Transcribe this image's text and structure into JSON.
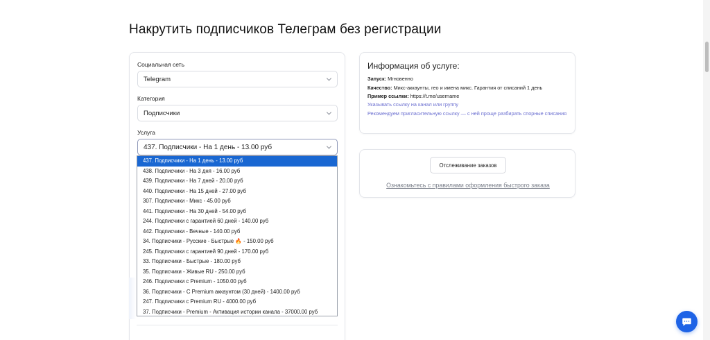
{
  "page": {
    "title": "Накрутить подписчиков Телеграм без регистрации"
  },
  "form": {
    "social_label": "Социальная сеть",
    "social_value": "Telegram",
    "category_label": "Категория",
    "category_value": "Подписчики",
    "service_label": "Услуга",
    "service_value": "437. Подписчики - На 1 день - 13.00 руб",
    "service_options": [
      "437. Подписчики - На 1 день - 13.00 руб",
      "438. Подписчики - На 3 дня - 16.00 руб",
      "439. Подписчики - На 7 дней - 20.00 руб",
      "440. Подписчики - На 15 дней - 27.00 руб",
      "307. Подписчики - Микс - 45.00 руб",
      "441. Подписчики - На 30 дней - 54.00 руб",
      "244. Подписчики с гарантией 60 дней - 140.00 руб",
      "442. Подписчики - Вечные - 140.00 руб",
      "34. Подписчики - Русские - Быстрые 🔥 - 150.00 руб",
      "245. Подписчики с гарантией 90 дней - 170.00 руб",
      "33. Подписчики - Быстрые - 180.00 руб",
      "35. Подписчики - Живые RU - 250.00 руб",
      "246. Подписчики с Premium - 1050.00 руб",
      "36. Подписчики - С Premium аккаунтом (30 дней) - 1400.00 руб",
      "247. Подписчики с Premium RU - 4000.00 руб",
      "37. Подписчики - Premium - Активация истории канала - 37000.00 руб"
    ]
  },
  "info": {
    "title": "Информация об услуге:",
    "launch_label": "Запуск:",
    "launch_value": "Мгновенно",
    "quality_label": "Качество:",
    "quality_value": "Микс-аккаунты, гео и имена микс. Гарантия от списаний 1 день",
    "example_label": "Пример ссылки:",
    "example_value": "https://t.me/username",
    "link_hint": "Указывать ссылку на канал или группу",
    "recommend_hint": "Рекомендуем пригласительную ссылку — с ней проще разбирать спорные списания"
  },
  "tracking": {
    "button_label": "Отслеживание заказов",
    "rules_link": "Ознакомьтесь с правилами оформления быстрого заказа"
  },
  "colors": {
    "accent": "#1967d2",
    "link": "#6b6fd0",
    "chat": "#1e63e6"
  },
  "icons": {
    "chat": "chat-bubble-icon",
    "select": "chevron-down-icon"
  }
}
